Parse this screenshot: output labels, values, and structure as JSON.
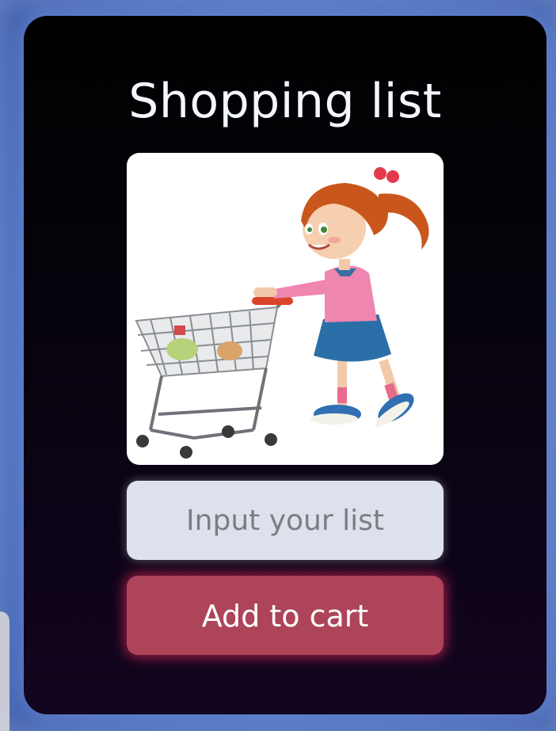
{
  "app": {
    "title": "Shopping list"
  },
  "hero": {
    "image": "girl-pushing-shopping-cart-illustration"
  },
  "list_input": {
    "placeholder": "Input your list",
    "value": ""
  },
  "actions": {
    "add_label": "Add to cart"
  },
  "colors": {
    "background": "#4a6fbe",
    "card_top": "#000000",
    "card_bottom": "#120520",
    "input_bg": "#dde1ec",
    "button_bg": "#ad4459",
    "button_glow": "#dc285a",
    "title_text": "#f3f6ff"
  }
}
